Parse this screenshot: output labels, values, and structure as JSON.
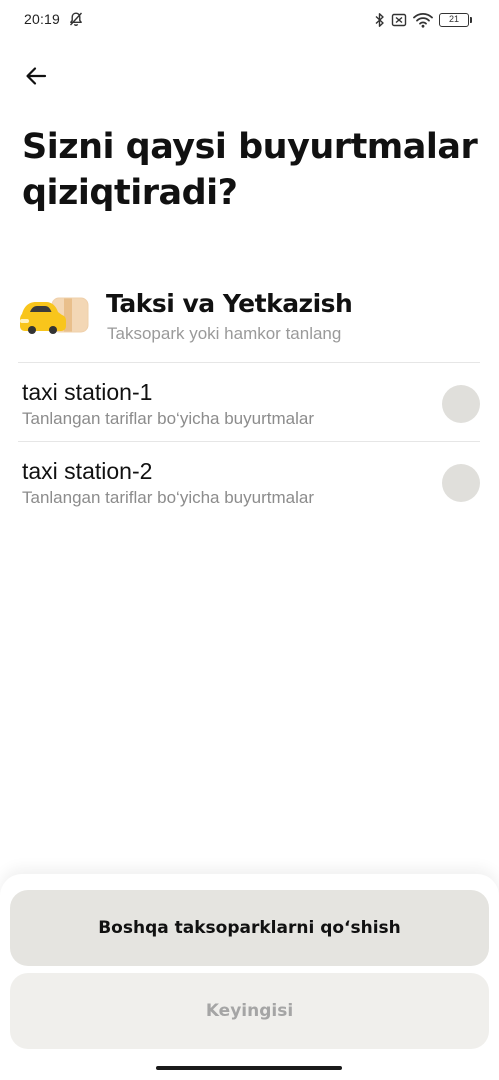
{
  "status_bar": {
    "time": "20:19",
    "battery": "21"
  },
  "header": {
    "title": "Sizni qaysi buyurtmalar qiziqtiradi?"
  },
  "park": {
    "title": "Taksi va Yetkazish",
    "subtitle": "Taksopark yoki hamkor tanlang",
    "logo_icon": "taxi-delivery-icon"
  },
  "stations": [
    {
      "name": "taxi station-1",
      "description": "Tanlangan tariflar bo‘yicha buyurtmalar",
      "selected": false
    },
    {
      "name": "taxi station-2",
      "description": "Tanlangan tariflar bo‘yicha buyurtmalar",
      "selected": false
    }
  ],
  "actions": {
    "add_parks_label": "Boshqa taksoparklarni qo‘shish",
    "next_label": "Keyingisi"
  },
  "colors": {
    "radio_unselected": "#e0dfdb",
    "button_primary_bg": "#e5e4e0",
    "button_disabled_bg": "#f0efec",
    "taxi_yellow": "#f8c51c"
  }
}
